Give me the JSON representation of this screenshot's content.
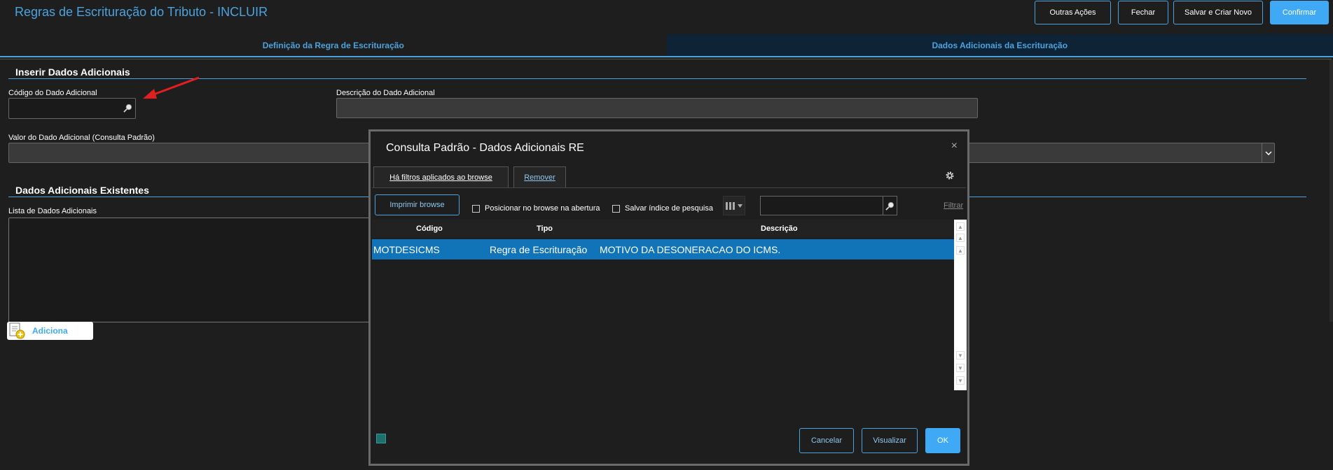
{
  "header": {
    "title": "Regras de Escrituração do Tributo - INCLUIR",
    "buttons": {
      "other_actions": "Outras Ações",
      "close": "Fechar",
      "save_new": "Salvar e Criar Novo",
      "confirm": "Confirmar"
    }
  },
  "tabs": [
    {
      "label": "Definição da Regra de Escrituração",
      "active": false
    },
    {
      "label": "Dados Adicionais da Escrituração",
      "active": true
    }
  ],
  "form": {
    "insert_section_title": "Inserir Dados Adicionais",
    "code_label": "Código do Dado Adicional",
    "code_value": "",
    "description_label": "Descrição do Dado Adicional",
    "description_value": "",
    "value_label": "Valor do Dado Adicional (Consulta Padrão)",
    "value_selected": "",
    "existing_section_title": "Dados Adicionais Existentes",
    "list_label": "Lista de Dados Adicionais",
    "add_button": "Adiciona"
  },
  "modal": {
    "title": "Consulta Padrão - Dados Adicionais RE",
    "close_glyph": "×",
    "filters_applied": "Há filtros aplicados ao browse",
    "remove": "Remover",
    "print_browse": "Imprimir browse",
    "position_on_open": "Posicionar no browse na abertura",
    "save_search_index": "Salvar índice de pesquisa",
    "search_value": "",
    "filter_link": "Filtrar",
    "columns": {
      "code": "Código",
      "type": "Tipo",
      "description": "Descrição"
    },
    "rows": [
      {
        "code": "MOTDESICMS",
        "type": "Regra de Escrituração",
        "description": "MOTIVO DA DESONERACAO DO ICMS."
      }
    ],
    "buttons": {
      "cancel": "Cancelar",
      "view": "Visualizar",
      "ok": "OK"
    }
  },
  "colors": {
    "accent": "#4aa3df",
    "primary_button": "#3fa9f5",
    "selected_row": "#1174b8",
    "background": "#1e1e1e",
    "annotation_arrow": "#e02020"
  },
  "icons": [
    "search-icon",
    "gear-icon",
    "close-icon",
    "columns-icon",
    "chevron-down-icon",
    "add-document-icon",
    "scroll-up-icon",
    "scroll-down-icon",
    "legend-icon",
    "annotation-arrow"
  ]
}
